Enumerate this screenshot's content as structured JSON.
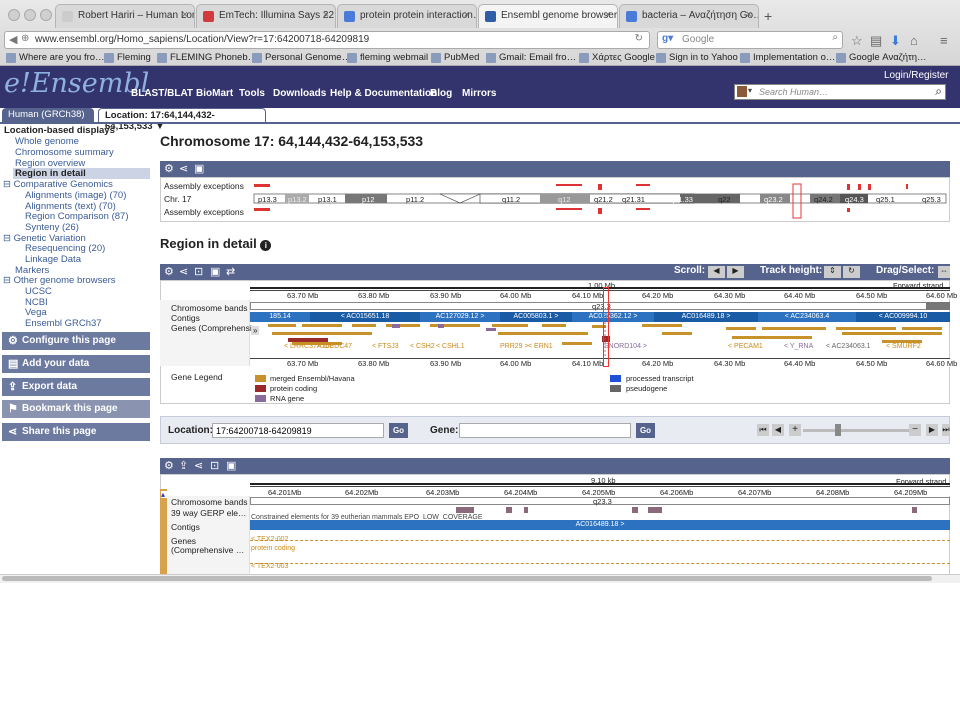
{
  "browser": {
    "tabs": [
      {
        "title": "Robert Hariri – Human Longev…",
        "icon_color": "#cccccc"
      },
      {
        "title": "EmTech: Illumina Says 22…",
        "icon_color": "#d23b3b"
      },
      {
        "title": "protein protein interaction…",
        "icon_color": "#4a7bd8"
      },
      {
        "title": "Ensembl genome browser…",
        "icon_color": "#2f5ea8"
      },
      {
        "title": "bacteria – Αναζήτηση Go…",
        "icon_color": "#4a7bd8"
      }
    ],
    "new_tab": "+",
    "url": "www.ensembl.org/Homo_sapiens/Location/View?r=17:64200718-64209819",
    "search_placeholder": "Google",
    "bookmarks": [
      "Where are you fro…",
      "Fleming",
      "FLEMING Phoneb…",
      "Personal Genome…",
      "fleming webmail",
      "PubMed",
      "Gmail: Email fro…",
      "Χάρτες Google",
      "Sign in to Yahoo",
      "Implementation o…",
      "Google Αναζήτη…"
    ]
  },
  "ensembl": {
    "logo": "e!Ensembl",
    "nav": [
      "BLAST/BLAT",
      "BioMart",
      "Tools",
      "Downloads",
      "Help & Documentation",
      "Blog",
      "Mirrors"
    ],
    "login": "Login/Register",
    "search_placeholder": "Search Human…",
    "species_tab": "Human (GRCh38)",
    "location_tab": "Location: 17:64,144,432-64,153,533"
  },
  "left_panel": {
    "heading": "Location-based displays",
    "items": [
      {
        "label": "Whole genome",
        "level": 1
      },
      {
        "label": "Chromosome summary",
        "level": 1
      },
      {
        "label": "Region overview",
        "level": 1
      },
      {
        "label": "Region in detail",
        "level": 1,
        "selected": true
      },
      {
        "label": "Comparative Genomics",
        "level": 0
      },
      {
        "label": "Alignments (image) (70)",
        "level": 2
      },
      {
        "label": "Alignments (text) (70)",
        "level": 2
      },
      {
        "label": "Region Comparison (87)",
        "level": 2
      },
      {
        "label": "Synteny (26)",
        "level": 2
      },
      {
        "label": "Genetic Variation",
        "level": 0
      },
      {
        "label": "Resequencing (20)",
        "level": 2
      },
      {
        "label": "Linkage Data",
        "level": 2
      },
      {
        "label": "Markers",
        "level": 0
      },
      {
        "label": "Other genome browsers",
        "level": 0
      },
      {
        "label": "UCSC",
        "level": 2
      },
      {
        "label": "NCBI",
        "level": 2
      },
      {
        "label": "Vega",
        "level": 2
      },
      {
        "label": "Ensembl GRCh37",
        "level": 2
      }
    ],
    "buttons": [
      "Configure this page",
      "Add your data",
      "Export data",
      "Bookmark this page",
      "Share this page"
    ]
  },
  "main": {
    "title": "Chromosome 17: 64,144,432-64,153,533",
    "chromosome": {
      "label_exceptions_top": "Assembly exceptions",
      "label_chr": "Chr. 17",
      "label_exceptions_bottom": "Assembly exceptions",
      "bands": [
        "p13.3",
        "p13.2",
        "p13.1",
        "p12",
        "p11.2",
        "q11.2",
        "q12",
        "q21.2",
        "q21.31",
        "q21.33",
        "q22",
        "q23.2",
        "q24.2",
        "q24.3",
        "q25.1",
        "q25.3"
      ]
    },
    "region_title": "Region in detail",
    "region": {
      "scroll_label": "Scroll:",
      "track_height_label": "Track height:",
      "drag_label": "Drag/Select:",
      "span_label": "1.00 Mb",
      "strand_label": "Forward strand",
      "ticks": [
        "63.70 Mb",
        "63.80 Mb",
        "63.90 Mb",
        "64.00 Mb",
        "64.10 Mb",
        "64.20 Mb",
        "64.30 Mb",
        "64.40 Mb",
        "64.50 Mb",
        "64.60 Mb"
      ],
      "band_label": "q23.3",
      "tracks": [
        "Chromosome bands",
        "Contigs",
        "Genes (Comprehensi…"
      ],
      "contigs": [
        "185.14",
        "< AC015651.18",
        "AC127029.12 >",
        "AC005803.1 >",
        "AC025362.12 >",
        "AC016489.18 >",
        "< AC234063.4",
        "< AC009994.10"
      ],
      "genes": [
        "< LRRC37A16P",
        "< CCDC47",
        "< FTSJ3",
        "< CSH2",
        "< CSHL1",
        "PRR29 >",
        "< ERN1",
        "SNORD104 >",
        "< PECAM1",
        "< Y_RNA",
        "< AC234063.1",
        "< SMURF2"
      ],
      "legend_title": "Gene Legend",
      "legend": [
        {
          "label": "merged Ensembl/Havana",
          "color": "#c8922a"
        },
        {
          "label": "protein coding",
          "color": "#9a2a2a"
        },
        {
          "label": "RNA gene",
          "color": "#8a6a9a"
        },
        {
          "label": "processed transcript",
          "color": "#2050d8"
        },
        {
          "label": "pseudogene",
          "color": "#666666"
        }
      ]
    },
    "nav_bar": {
      "location_label": "Location:",
      "location_value": "17:64200718-64209819",
      "gene_label": "Gene:",
      "gene_value": "",
      "go": "Go"
    },
    "detail": {
      "span_label": "9.10 kb",
      "strand_label": "Forward strand",
      "ticks": [
        "64.201Mb",
        "64.202Mb",
        "64.203Mb",
        "64.204Mb",
        "64.205Mb",
        "64.206Mb",
        "64.207Mb",
        "64.208Mb",
        "64.209Mb"
      ],
      "band_label": "q23.3",
      "tracks": [
        "Chromosome bands",
        "39 way GERP ele…",
        "Contigs",
        "Genes",
        "(Comprehensive …"
      ],
      "gerp_text": "Constrained elements for 39 eutherian mammals EPO_LOW_COVERAGE",
      "contig": "AC016489.18 >",
      "gene1": "< TEX2-002",
      "gene1_type": "protein coding",
      "gene2": "< TEX2-003"
    }
  }
}
